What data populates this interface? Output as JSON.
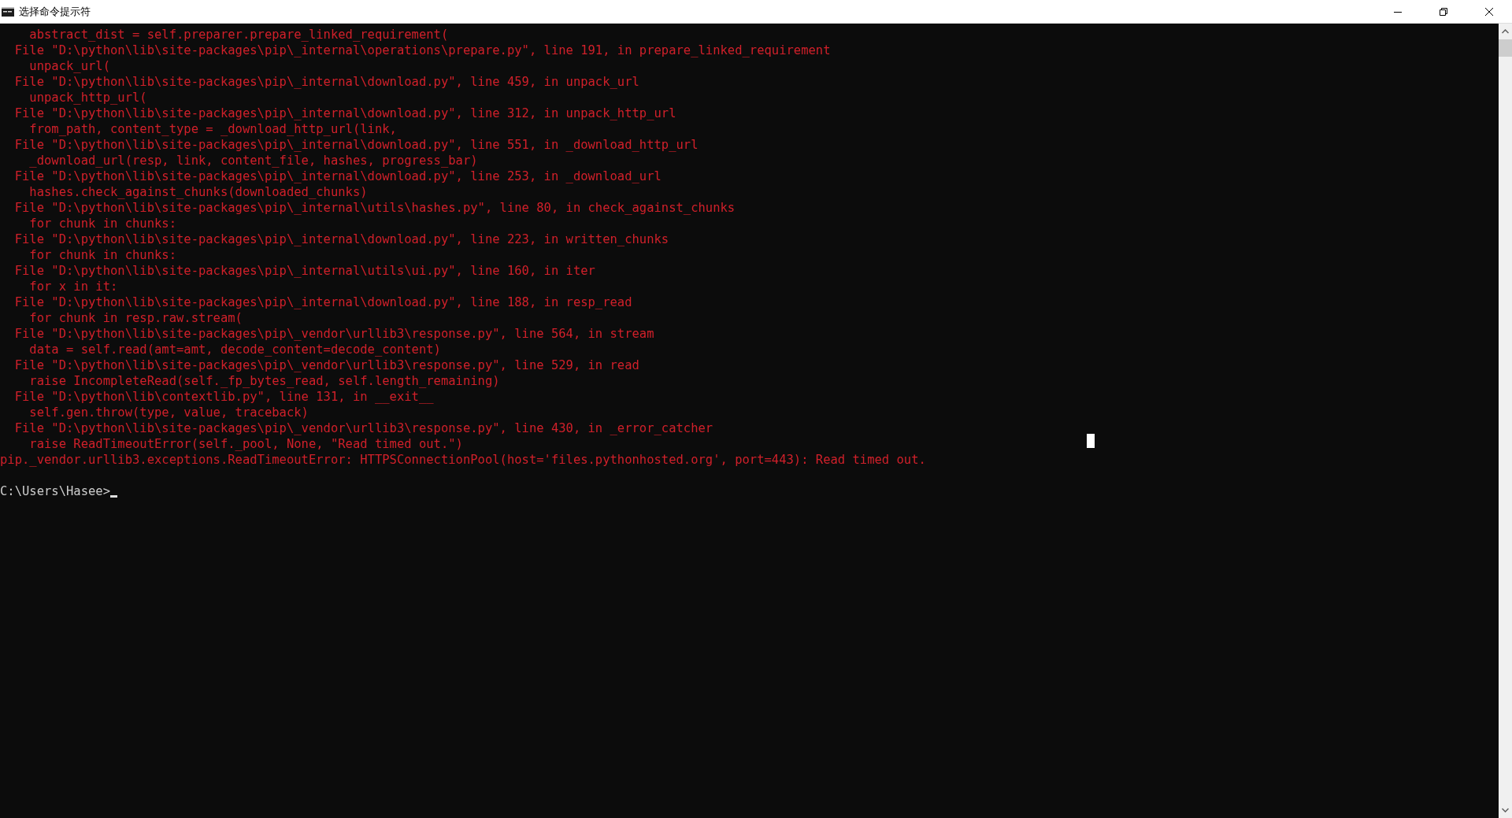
{
  "window": {
    "title": "选择命令提示符"
  },
  "console": {
    "lines": [
      {
        "kind": "error",
        "text": "    abstract_dist = self.preparer.prepare_linked_requirement("
      },
      {
        "kind": "error",
        "text": "  File \"D:\\python\\lib\\site-packages\\pip\\_internal\\operations\\prepare.py\", line 191, in prepare_linked_requirement"
      },
      {
        "kind": "error",
        "text": "    unpack_url("
      },
      {
        "kind": "error",
        "text": "  File \"D:\\python\\lib\\site-packages\\pip\\_internal\\download.py\", line 459, in unpack_url"
      },
      {
        "kind": "error",
        "text": "    unpack_http_url("
      },
      {
        "kind": "error",
        "text": "  File \"D:\\python\\lib\\site-packages\\pip\\_internal\\download.py\", line 312, in unpack_http_url"
      },
      {
        "kind": "error",
        "text": "    from_path, content_type = _download_http_url(link,"
      },
      {
        "kind": "error",
        "text": "  File \"D:\\python\\lib\\site-packages\\pip\\_internal\\download.py\", line 551, in _download_http_url"
      },
      {
        "kind": "error",
        "text": "    _download_url(resp, link, content_file, hashes, progress_bar)"
      },
      {
        "kind": "error",
        "text": "  File \"D:\\python\\lib\\site-packages\\pip\\_internal\\download.py\", line 253, in _download_url"
      },
      {
        "kind": "error",
        "text": "    hashes.check_against_chunks(downloaded_chunks)"
      },
      {
        "kind": "error",
        "text": "  File \"D:\\python\\lib\\site-packages\\pip\\_internal\\utils\\hashes.py\", line 80, in check_against_chunks"
      },
      {
        "kind": "error",
        "text": "    for chunk in chunks:"
      },
      {
        "kind": "error",
        "text": "  File \"D:\\python\\lib\\site-packages\\pip\\_internal\\download.py\", line 223, in written_chunks"
      },
      {
        "kind": "error",
        "text": "    for chunk in chunks:"
      },
      {
        "kind": "error",
        "text": "  File \"D:\\python\\lib\\site-packages\\pip\\_internal\\utils\\ui.py\", line 160, in iter"
      },
      {
        "kind": "error",
        "text": "    for x in it:"
      },
      {
        "kind": "error",
        "text": "  File \"D:\\python\\lib\\site-packages\\pip\\_internal\\download.py\", line 188, in resp_read"
      },
      {
        "kind": "error",
        "text": "    for chunk in resp.raw.stream("
      },
      {
        "kind": "error",
        "text": "  File \"D:\\python\\lib\\site-packages\\pip\\_vendor\\urllib3\\response.py\", line 564, in stream"
      },
      {
        "kind": "error",
        "text": "    data = self.read(amt=amt, decode_content=decode_content)"
      },
      {
        "kind": "error",
        "text": "  File \"D:\\python\\lib\\site-packages\\pip\\_vendor\\urllib3\\response.py\", line 529, in read"
      },
      {
        "kind": "error",
        "text": "    raise IncompleteRead(self._fp_bytes_read, self.length_remaining)"
      },
      {
        "kind": "error",
        "text": "  File \"D:\\python\\lib\\contextlib.py\", line 131, in __exit__"
      },
      {
        "kind": "error",
        "text": "    self.gen.throw(type, value, traceback)"
      },
      {
        "kind": "error",
        "text": "  File \"D:\\python\\lib\\site-packages\\pip\\_vendor\\urllib3\\response.py\", line 430, in _error_catcher"
      },
      {
        "kind": "error",
        "text": "    raise ReadTimeoutError(self._pool, None, \"Read timed out.\")"
      },
      {
        "kind": "error",
        "text": "pip._vendor.urllib3.exceptions.ReadTimeoutError: HTTPSConnectionPool(host='files.pythonhosted.org', port=443): Read timed out."
      },
      {
        "kind": "blank"
      },
      {
        "kind": "prompt",
        "text": "C:\\Users\\Hasee>"
      }
    ]
  }
}
